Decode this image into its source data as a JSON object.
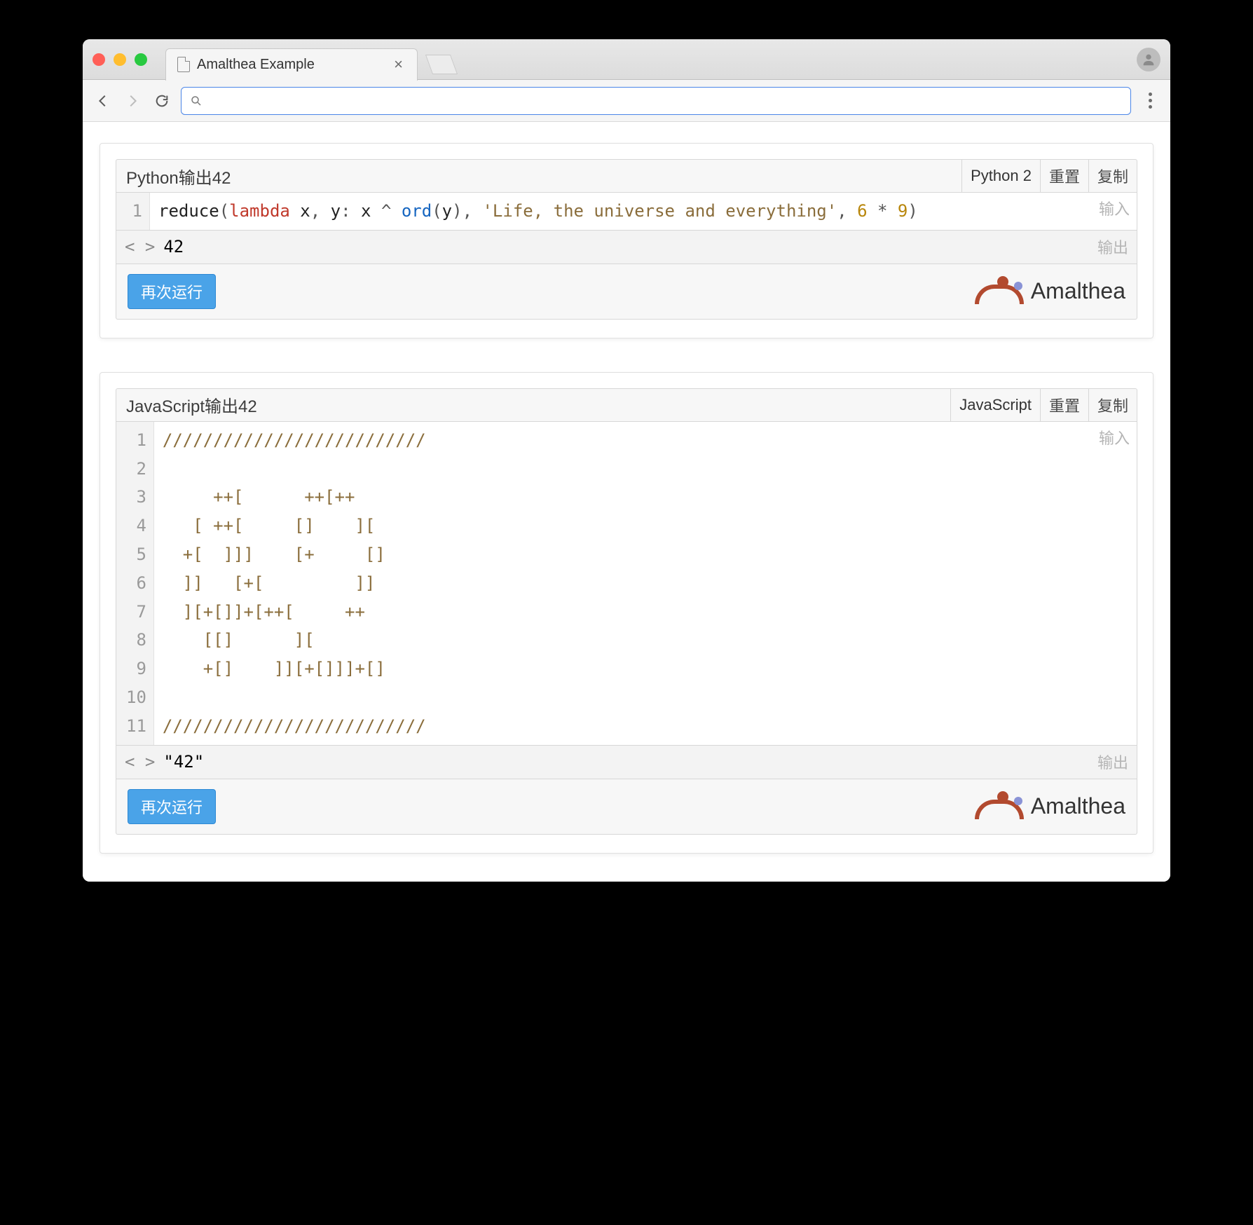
{
  "browser": {
    "tab_title": "Amalthea Example",
    "url": ""
  },
  "brand": {
    "name": "Amalthea"
  },
  "labels": {
    "reset": "重置",
    "copy": "复制",
    "input": "输入",
    "output": "输出",
    "run_again": "再次运行"
  },
  "cells": [
    {
      "title": "Python输出42",
      "language": "Python 2",
      "code_tokens": [
        {
          "t": "reduce",
          "c": ""
        },
        {
          "t": "(",
          "c": "tok-punc"
        },
        {
          "t": "lambda",
          "c": "tok-kw"
        },
        {
          "t": " x",
          "c": ""
        },
        {
          "t": ",",
          "c": "tok-punc"
        },
        {
          "t": " y",
          "c": ""
        },
        {
          "t": ":",
          "c": "tok-punc"
        },
        {
          "t": " x ",
          "c": ""
        },
        {
          "t": "^",
          "c": "tok-punc"
        },
        {
          "t": " ",
          "c": ""
        },
        {
          "t": "ord",
          "c": "tok-fn"
        },
        {
          "t": "(",
          "c": "tok-punc"
        },
        {
          "t": "y",
          "c": ""
        },
        {
          "t": ")",
          "c": "tok-punc"
        },
        {
          "t": ",",
          "c": "tok-punc"
        },
        {
          "t": " ",
          "c": ""
        },
        {
          "t": "'Life, the universe and everything'",
          "c": "tok-str"
        },
        {
          "t": ",",
          "c": "tok-punc"
        },
        {
          "t": " ",
          "c": ""
        },
        {
          "t": "6",
          "c": "tok-num"
        },
        {
          "t": " * ",
          "c": "tok-punc"
        },
        {
          "t": "9",
          "c": "tok-num"
        },
        {
          "t": ")",
          "c": "tok-punc"
        }
      ],
      "line_count": 1,
      "output": "42"
    },
    {
      "title": "JavaScript输出42",
      "language": "JavaScript",
      "code_lines": [
        "//////////////////////////",
        "",
        "     ++[      ++[++",
        "   [ ++[     []    ][",
        "  +[  ]]]    [+     []",
        "  ]]   [+[         ]]",
        "  ][+[]]+[++[     ++",
        "    [[]      ][",
        "    +[]    ]][+[]]]+[]",
        "",
        "//////////////////////////"
      ],
      "line_count": 11,
      "output": "\"42\""
    }
  ]
}
